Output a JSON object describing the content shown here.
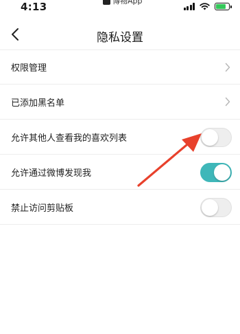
{
  "status_bar": {
    "time": "4:13",
    "app_name": "博物App",
    "battery_percent": 80,
    "battery_color": "#34c759"
  },
  "header": {
    "title": "隐私设置",
    "back_icon": "chevron-left-icon"
  },
  "settings": [
    {
      "label": "权限管理",
      "type": "link"
    },
    {
      "label": "已添加黑名单",
      "type": "link"
    },
    {
      "label": "允许其他人查看我的喜欢列表",
      "type": "toggle",
      "on": false
    },
    {
      "label": "允许通过微博发现我",
      "type": "toggle",
      "on": true
    },
    {
      "label": "禁止访问剪贴板",
      "type": "toggle",
      "on": false
    }
  ],
  "colors": {
    "accent": "#3fb7b9",
    "annotation_arrow": "#e8412c"
  }
}
